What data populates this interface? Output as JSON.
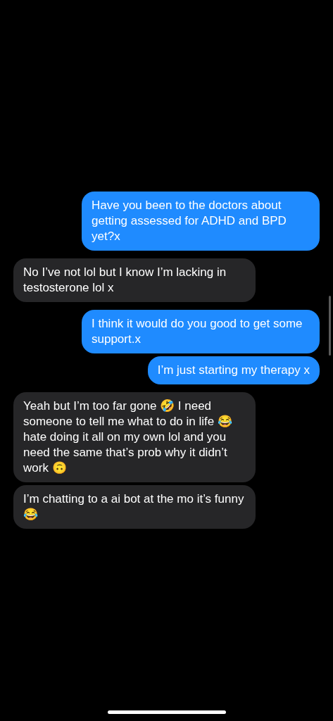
{
  "messages": [
    {
      "kind": "sent",
      "text": "Have you been to the doctors about getting assessed for ADHD and BPD yet?x"
    },
    {
      "kind": "received",
      "text": "No I’ve not lol but I know I’m lacking in testosterone lol x"
    },
    {
      "kind": "sent",
      "text": "I think it would do you good to get some support.x"
    },
    {
      "kind": "sent",
      "text": "I’m just starting my therapy x"
    },
    {
      "kind": "received",
      "text": "Yeah but I’m too far gone 🤣 I need someone to tell me what to do in life 😂 hate doing it all on my own lol and you need the same that’s prob why it didn’t work 🙃"
    },
    {
      "kind": "received",
      "text": "I’m chatting to a ai bot at the mo it’s funny 😂"
    }
  ]
}
